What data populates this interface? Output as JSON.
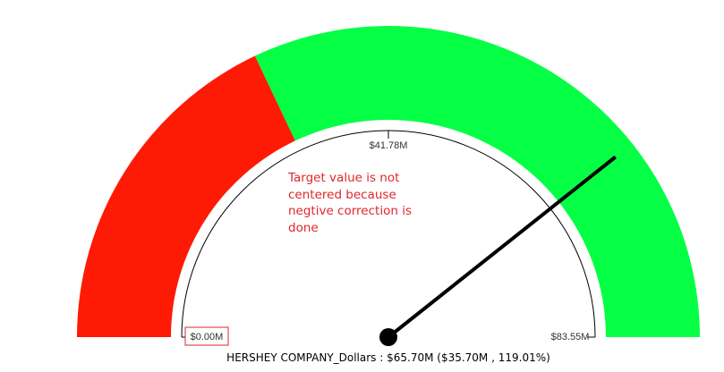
{
  "chart_data": {
    "type": "gauge",
    "min": 0,
    "max": 83.55,
    "value": 65.7,
    "unit": "$M",
    "bands": [
      {
        "from": 0,
        "to": 30,
        "color": "#ff1a05"
      },
      {
        "from": 30,
        "to": 83.55,
        "color": "#05ff45"
      }
    ],
    "needle_color": "#000000",
    "tick_labels": {
      "min": "$0.00M",
      "mid": "$41.78M",
      "max": "$83.55M"
    },
    "annotation": "Target value is not centered because negtive correction is done",
    "caption": "HERSHEY COMPANY_Dollars : $65.70M ($35.70M , 119.01%)"
  }
}
